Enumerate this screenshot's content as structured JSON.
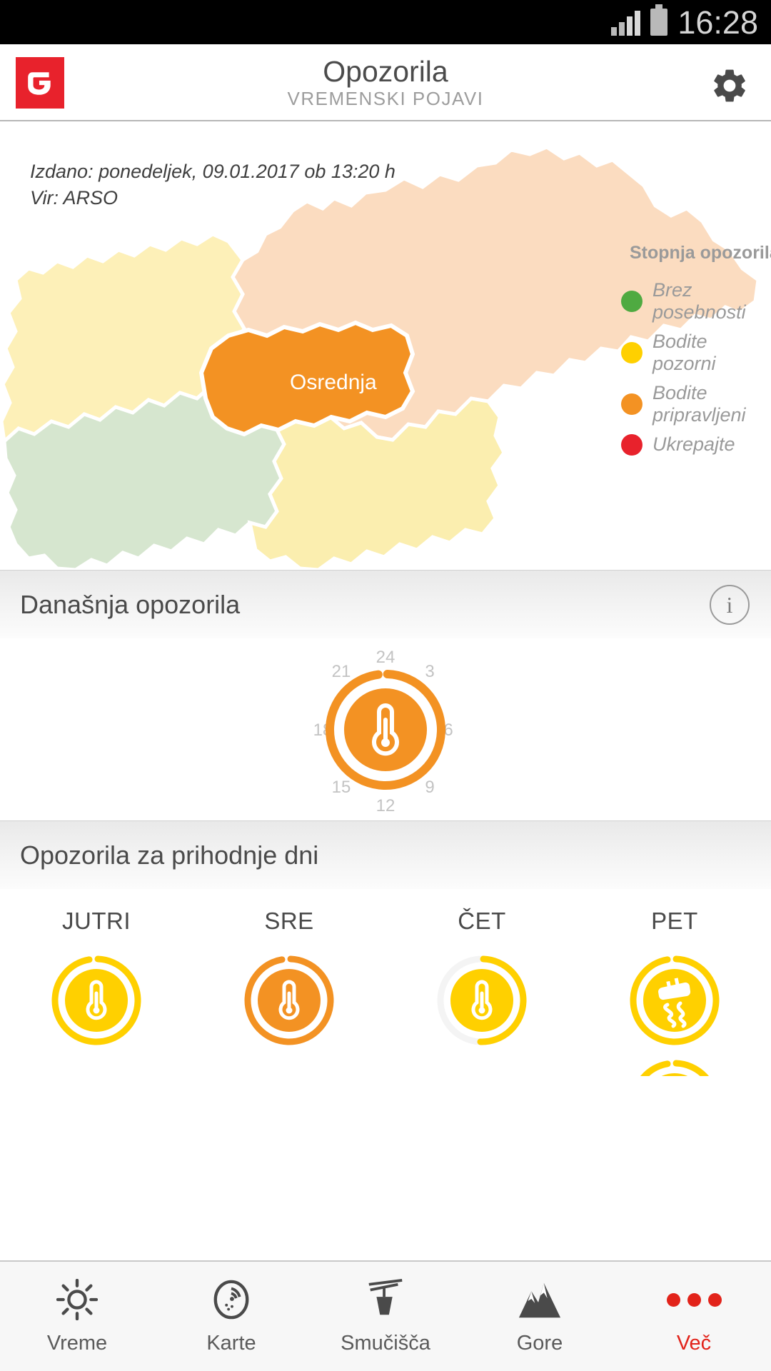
{
  "statusbar": {
    "time": "16:28",
    "signal_icon": "signal-bars-icon",
    "battery_icon": "battery-icon"
  },
  "header": {
    "logo_name": "app-logo",
    "title": "Opozorila",
    "subtitle": "VREMENSKI POJAVI",
    "settings_icon": "gear-icon"
  },
  "map": {
    "issued_line1": "Izdano: ponedeljek, 09.01.2017 ob 13:20 h",
    "issued_line2": "Vir: ARSO",
    "selected_region": "Osrednja",
    "region_colors": {
      "selected": "#f39223",
      "northeast": "#fbdcc0",
      "northwest": "#fdf0b8",
      "southwest": "#d6e6cf",
      "southeast": "#fbeeaf"
    },
    "legend": {
      "title": "Stopnja opozorila",
      "items": [
        {
          "label": "Brez posebnosti",
          "color": "#4faa41"
        },
        {
          "label": "Bodite pozorni",
          "color": "#ffd000"
        },
        {
          "label": "Bodite pripravljeni",
          "color": "#f39223"
        },
        {
          "label": "Ukrepajte",
          "color": "#e8222c"
        }
      ]
    }
  },
  "today": {
    "section_title": "Današnja opozorila",
    "info_icon": "info-icon",
    "info_label": "i",
    "dial": {
      "hours": [
        "24",
        "3",
        "6",
        "9",
        "12",
        "15",
        "18",
        "21"
      ],
      "icon": "thermometer-icon",
      "color": "#f39223",
      "arc_start_hour": 0,
      "arc_end_hour": 24
    }
  },
  "future": {
    "section_title": "Opozorila za prihodnje dni",
    "days": [
      {
        "name": "JUTRI",
        "icons": [
          {
            "type": "thermometer-icon",
            "color": "#ffd000",
            "arc_from": 30,
            "arc_to": 350
          }
        ]
      },
      {
        "name": "SRE",
        "icons": [
          {
            "type": "thermometer-icon",
            "color": "#f39223",
            "arc_from": 5,
            "arc_to": 355
          }
        ]
      },
      {
        "name": "ČET",
        "icons": [
          {
            "type": "thermometer-icon",
            "color": "#ffd000",
            "arc_from": 10,
            "arc_to": 190
          }
        ]
      },
      {
        "name": "PET",
        "icons": [
          {
            "type": "slippery-road-icon",
            "color": "#ffd000",
            "arc_from": 5,
            "arc_to": 355
          },
          {
            "type": "thermometer-icon",
            "color": "#ffd000",
            "arc_from": 5,
            "arc_to": 355
          }
        ]
      }
    ]
  },
  "tabbar": {
    "items": [
      {
        "label": "Vreme",
        "icon": "sun-icon",
        "active": false
      },
      {
        "label": "Karte",
        "icon": "radar-icon",
        "active": false
      },
      {
        "label": "Smučišča",
        "icon": "ski-lift-icon",
        "active": false
      },
      {
        "label": "Gore",
        "icon": "mountain-icon",
        "active": false
      },
      {
        "label": "Več",
        "icon": "more-dots-icon",
        "active": true
      }
    ]
  }
}
